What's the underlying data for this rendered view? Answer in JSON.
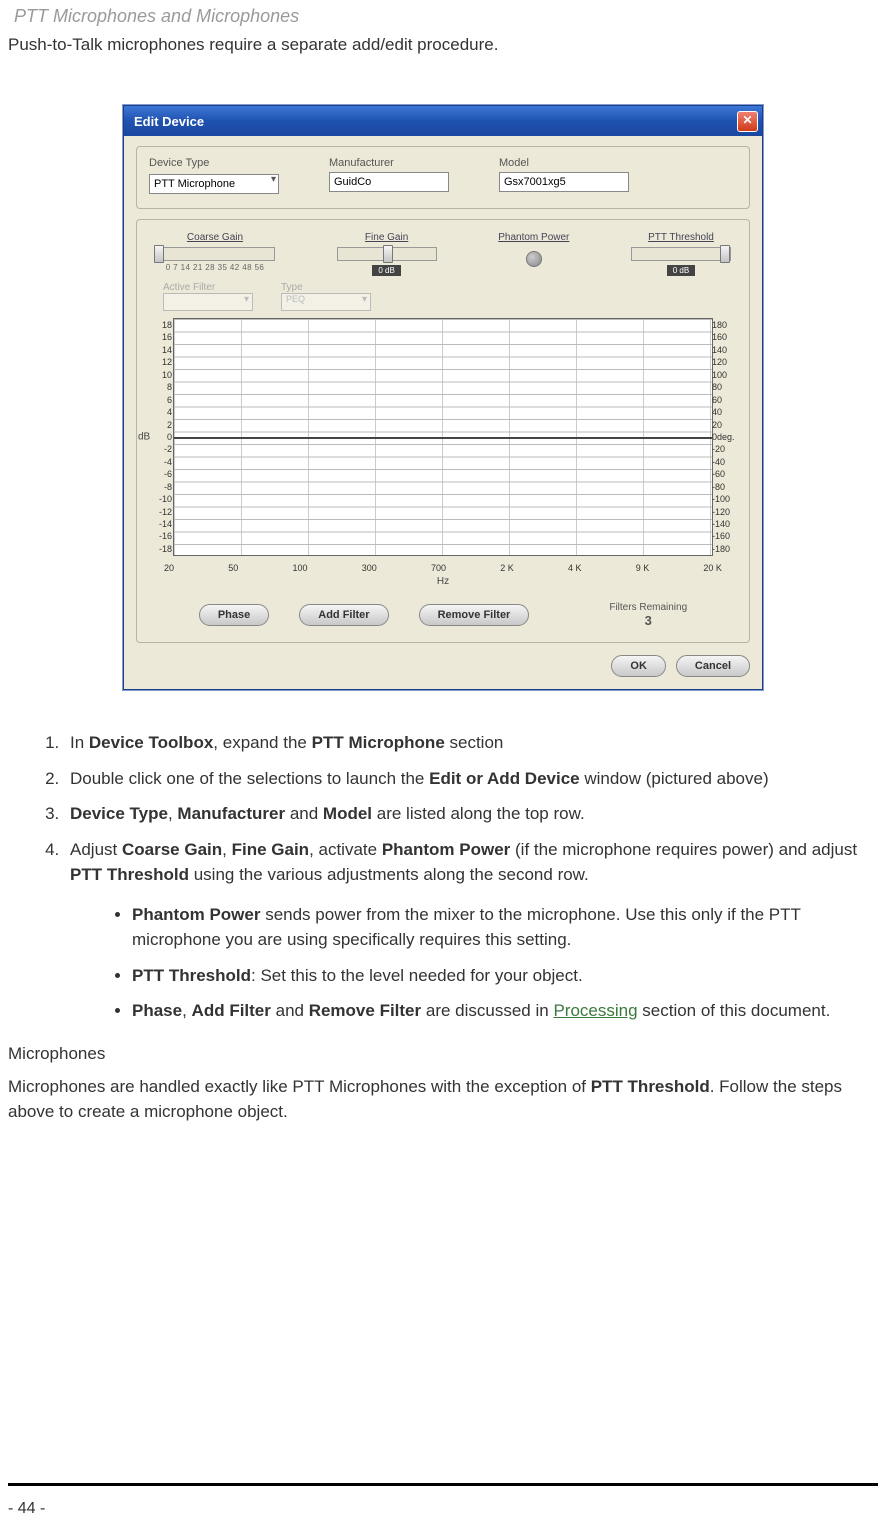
{
  "header": {
    "title": "PTT Microphones and Microphones"
  },
  "intro": "Push-to-Talk microphones require a separate add/edit procedure.",
  "window": {
    "title": "Edit Device",
    "close": "✕",
    "fields": {
      "device_type": {
        "label": "Device Type",
        "value": "PTT Microphone"
      },
      "manufacturer": {
        "label": "Manufacturer",
        "value": "GuidCo"
      },
      "model": {
        "label": "Model",
        "value": "Gsx7001xg5"
      }
    },
    "sliders": {
      "coarse": {
        "label": "Coarse Gain",
        "scale": "0  7  14  21  28  35  42  48  56"
      },
      "fine": {
        "label": "Fine Gain",
        "badge": "0 dB"
      },
      "phantom": {
        "label": "Phantom Power"
      },
      "ptt": {
        "label": "PTT Threshold",
        "badge": "0 dB"
      }
    },
    "disabled": {
      "active_filter": "Active Filter",
      "type": "Type",
      "type_value": "PEQ"
    },
    "graph": {
      "unit_left": "dB",
      "y_left": [
        "18",
        "16",
        "14",
        "12",
        "10",
        "8",
        "6",
        "4",
        "2",
        "0",
        "-2",
        "-4",
        "-6",
        "-8",
        "-10",
        "-12",
        "-14",
        "-16",
        "-18"
      ],
      "y_right": [
        "180",
        "160",
        "140",
        "120",
        "100",
        "80",
        "60",
        "40",
        "20",
        "0deg.",
        "-20",
        "-40",
        "-60",
        "-80",
        "-100",
        "-120",
        "-140",
        "-160",
        "-180"
      ],
      "x": [
        "20",
        "50",
        "100",
        "300",
        "700",
        "2 K",
        "4 K",
        "9 K",
        "20 K"
      ],
      "hz": "Hz"
    },
    "buttons": {
      "phase": "Phase",
      "add_filter": "Add Filter",
      "remove_filter": "Remove Filter",
      "filters_remaining_label": "Filters Remaining",
      "filters_remaining_value": "3",
      "ok": "OK",
      "cancel": "Cancel"
    }
  },
  "steps": {
    "s1": {
      "pre": "In ",
      "b1": "Device Toolbox",
      "mid": ", expand the ",
      "b2": "PTT Microphone",
      "post": " section"
    },
    "s2": {
      "pre": "Double click one of the selections to launch the ",
      "b1": "Edit or Add Device",
      "post": " window (pictured above)"
    },
    "s3": {
      "b1": "Device Type",
      "c1": ", ",
      "b2": "Manufacturer",
      "c2": " and ",
      "b3": "Model",
      "post": " are listed along the top row."
    },
    "s4": {
      "pre": "Adjust ",
      "b1": "Coarse Gain",
      "c1": ", ",
      "b2": "Fine Gain",
      "c2": ", activate ",
      "b3": "Phantom Power",
      "c3": " (if the microphone requires power) and adjust ",
      "b4": "PTT Threshold",
      "post": " using the various adjustments along the second row."
    }
  },
  "sub": {
    "i1": {
      "b1": "Phantom Power",
      "post": " sends power from the mixer to the microphone. Use this only if the PTT microphone you are using specifically requires this setting."
    },
    "i2": {
      "b1": "PTT Threshold",
      "post": ": Set this to the level needed for your object."
    },
    "i3": {
      "b1": "Phase",
      "c1": ", ",
      "b2": "Add Filter",
      "c2": " and ",
      "b3": "Remove Filter",
      "c3": " are discussed in ",
      "link": "Processing",
      "post": " section of this document."
    }
  },
  "mic_section": {
    "heading": "Microphones",
    "p_pre": "Microphones are handled exactly like PTT Microphones with the exception of ",
    "p_b": "PTT Threshold",
    "p_post": ". Follow the steps above to create a microphone object."
  },
  "footer": {
    "page": "- 44 -"
  }
}
